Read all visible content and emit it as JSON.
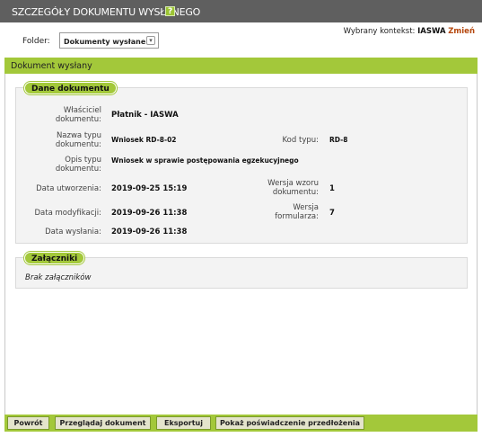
{
  "header": {
    "title": "SZCZEGÓŁY DOKUMENTU WYSŁANEGO",
    "help_label": "?"
  },
  "folder": {
    "label": "Folder:",
    "selected": "Dokumenty wysłane",
    "arrow": "▾"
  },
  "context": {
    "label": "Wybrany kontekst:",
    "value": "IASWA",
    "change_label": "Zmień"
  },
  "panel": {
    "title": "Dokument wysłany"
  },
  "document_data": {
    "title": "Dane dokumentu",
    "fields": {
      "owner_label": "Właściciel dokumentu:",
      "owner_value": "Płatnik - IASWA",
      "type_name_label": "Nazwa typu dokumentu:",
      "type_name_value": "Wniosek RD-8-02",
      "type_code_label": "Kod typu:",
      "type_code_value": "RD-8",
      "type_desc_label": "Opis typu dokumentu:",
      "type_desc_value": "Wniosek w sprawie postępowania egzekucyjnego",
      "created_label": "Data utworzenia:",
      "created_value": "2019-09-25 15:19",
      "template_version_label": "Wersja wzoru dokumentu:",
      "template_version_value": "1",
      "modified_label": "Data modyfikacji:",
      "modified_value": "2019-09-26 11:38",
      "form_version_label": "Wersja formularza:",
      "form_version_value": "7",
      "sent_label": "Data wysłania:",
      "sent_value": "2019-09-26 11:38"
    }
  },
  "attachments": {
    "title": "Załączniki",
    "empty_text": "Brak załączników"
  },
  "buttons": {
    "back": "Powrót",
    "view": "Przeglądaj dokument",
    "export": "Eksportuj",
    "certificate": "Pokaż poświadczenie przedłożenia"
  },
  "colors": {
    "accent": "#a3c83a",
    "header_bg": "#5f5f5f",
    "link": "#b5470d"
  }
}
